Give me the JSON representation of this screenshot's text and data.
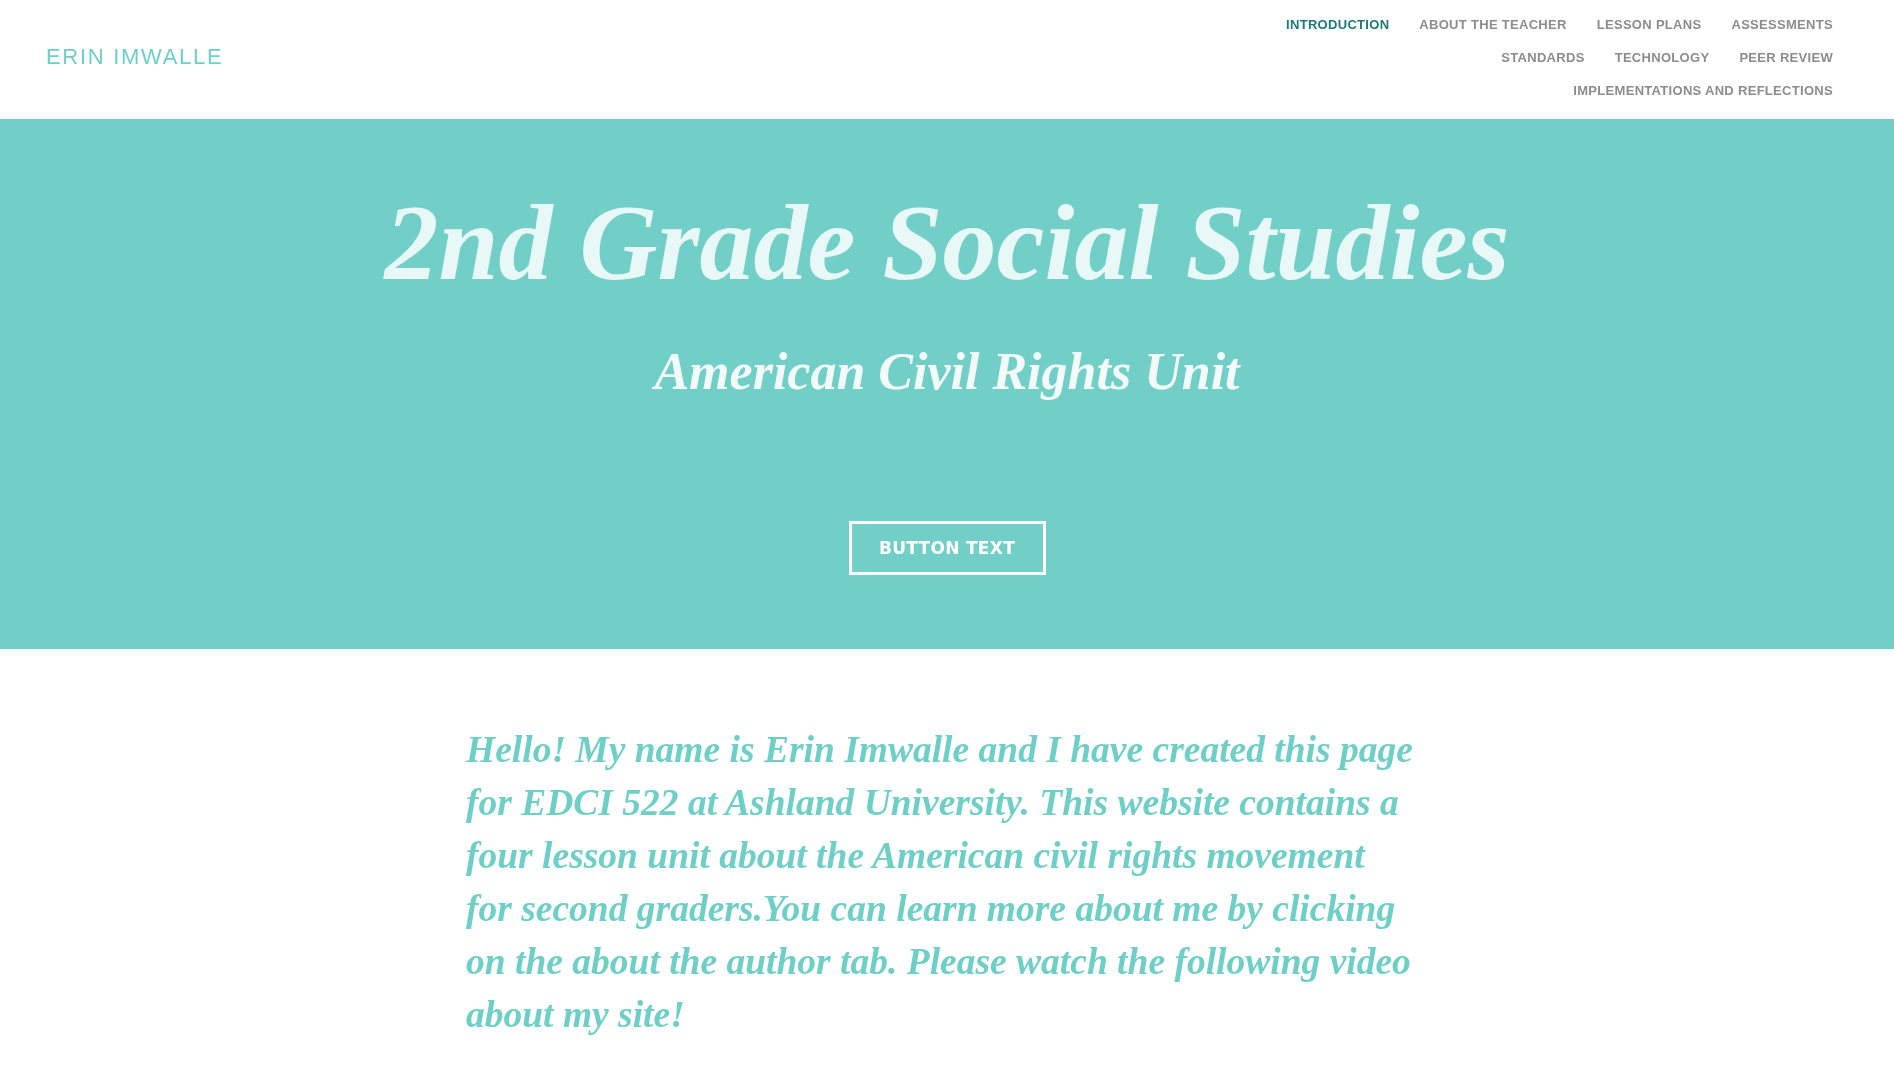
{
  "header": {
    "logo": "ERIN IMWALLE",
    "nav_rows": [
      {
        "items": [
          {
            "label": "INTRODUCTION",
            "selected": true
          },
          {
            "label": "ABOUT THE TEACHER",
            "selected": false
          },
          {
            "label": "LESSON PLANS",
            "selected": false
          },
          {
            "label": "ASSESSMENTS",
            "selected": false
          }
        ]
      },
      {
        "items": [
          {
            "label": "STANDARDS",
            "selected": false
          },
          {
            "label": "TECHNOLOGY",
            "selected": false
          },
          {
            "label": "PEER REVIEW",
            "selected": false
          }
        ]
      },
      {
        "items": [
          {
            "label": "IMPLEMENTATIONS AND REFLECTIONS",
            "selected": false
          }
        ]
      }
    ]
  },
  "hero": {
    "title": "2nd Grade Social Studies",
    "subtitle": "American Civil Rights Unit",
    "button": "BUTTON TEXT"
  },
  "intro": {
    "text": "Hello! My name is Erin Imwalle and I have created this page for EDCI 522 at Ashland University. This website contains a four lesson unit about the American civil rights movement for second graders.You can learn more about me by clicking on the about the author tab. Please watch the following video about my site!"
  }
}
